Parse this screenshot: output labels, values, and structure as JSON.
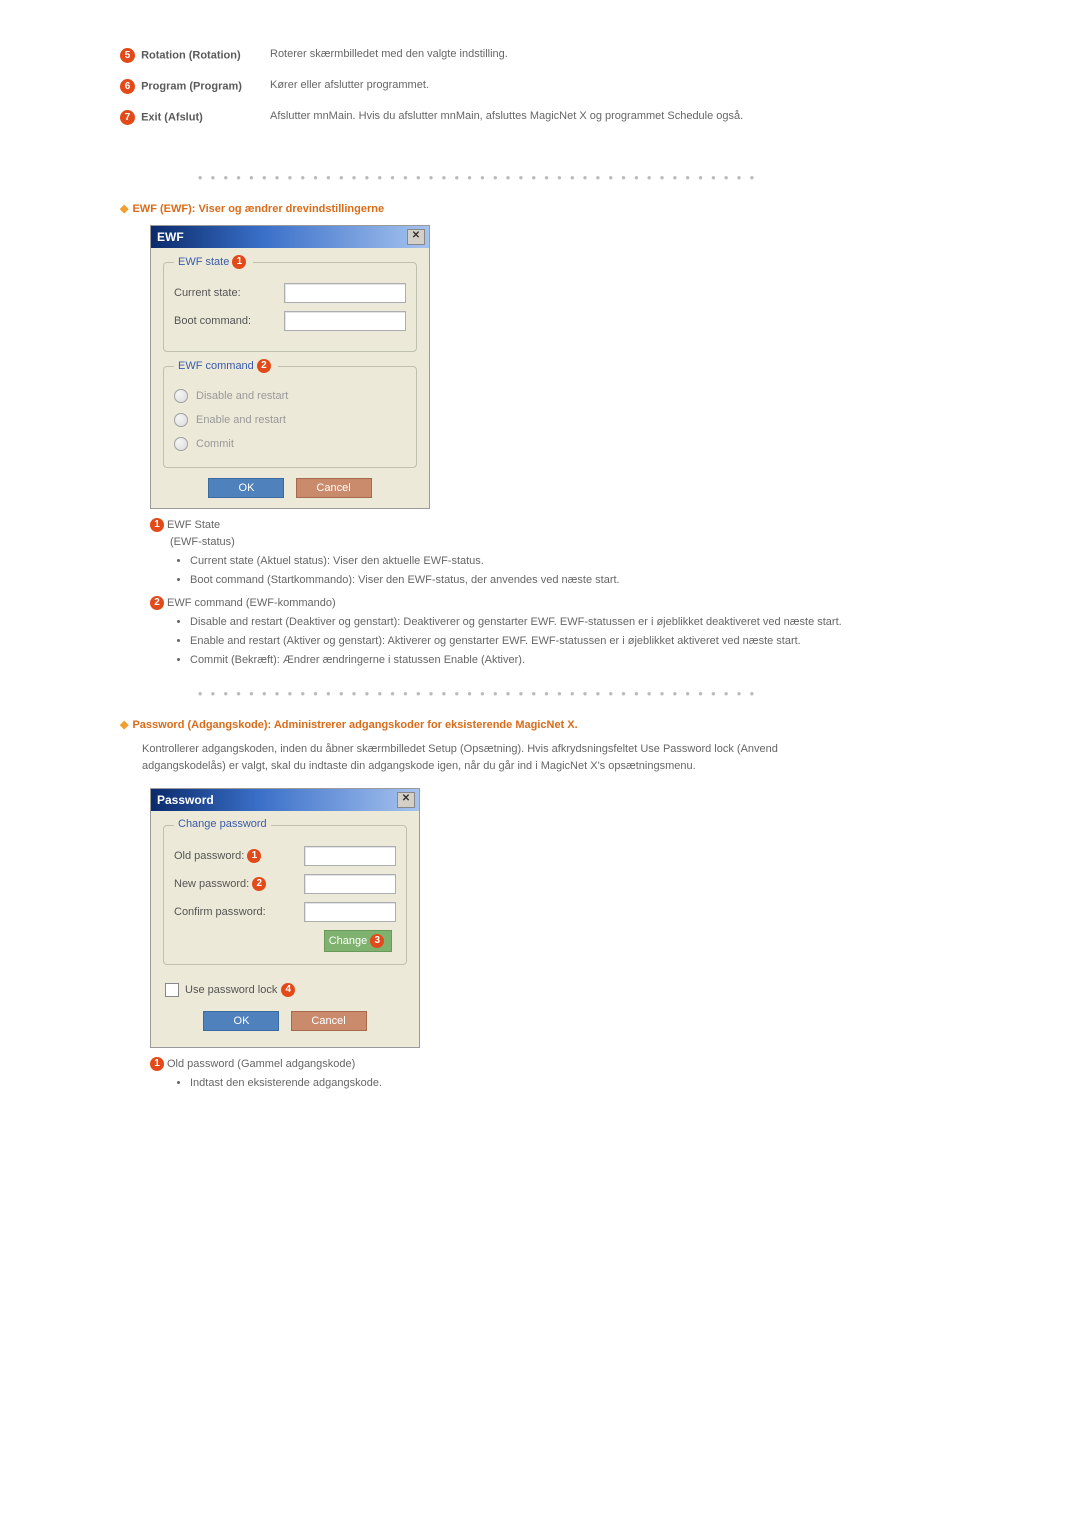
{
  "settings": {
    "rotation": {
      "num": "5",
      "label": "Rotation (Rotation)",
      "desc": "Roterer skærmbilledet med den valgte indstilling."
    },
    "program": {
      "num": "6",
      "label": "Program (Program)",
      "desc": "Kører eller afslutter programmet."
    },
    "exit": {
      "num": "7",
      "label": "Exit (Afslut)",
      "desc": "Afslutter mnMain. Hvis du afslutter mnMain, afsluttes MagicNet X og programmet Schedule også."
    }
  },
  "ewf": {
    "heading": "EWF (EWF): Viser og ændrer drevindstillingerne",
    "dialog_title": "EWF",
    "state_legend": "EWF state",
    "state_num": "1",
    "current_state_label": "Current state:",
    "boot_cmd_label": "Boot command:",
    "cmd_legend": "EWF command",
    "cmd_num": "2",
    "radio_disable": "Disable and restart",
    "radio_enable": "Enable and restart",
    "radio_commit": "Commit",
    "ok_label": "OK",
    "cancel_label": "Cancel",
    "list": {
      "state_title": "EWF State",
      "state_sub": "(EWF-status)",
      "state_items": [
        "Current state (Aktuel status): Viser den aktuelle EWF-status.",
        "Boot command (Startkommando): Viser den EWF-status, der anvendes ved næste start."
      ],
      "cmd_title": "EWF command (EWF-kommando)",
      "cmd_items": [
        "Disable and restart (Deaktiver og genstart): Deaktiverer og genstarter EWF. EWF-statussen er i øjeblikket deaktiveret ved næste start.",
        "Enable and restart (Aktiver og genstart): Aktiverer og genstarter EWF. EWF-statussen er i øjeblikket aktiveret ved næste start.",
        "Commit (Bekræft): Ændrer ændringerne i statussen Enable (Aktiver)."
      ]
    }
  },
  "pwd": {
    "heading": "Password (Adgangskode): Administrerer adgangskoder for eksisterende MagicNet X.",
    "intro": "Kontrollerer adgangskoden, inden du åbner skærmbilledet Setup (Opsætning). Hvis afkrydsningsfeltet Use Password lock (Anvend adgangskodelås) er valgt, skal du indtaste din adgangskode igen, når du går ind i MagicNet X's opsætningsmenu.",
    "dialog_title": "Password",
    "group_legend": "Change password",
    "old_label": "Old password:",
    "old_num": "1",
    "new_label": "New password:",
    "new_num": "2",
    "confirm_label": "Confirm password:",
    "change_btn": "Change",
    "change_num": "3",
    "use_lock_label": "Use password lock",
    "use_lock_num": "4",
    "ok_label": "OK",
    "cancel_label": "Cancel",
    "list": {
      "old_num": "1",
      "old_title": "Old password (Gammel adgangskode)",
      "old_items": [
        "Indtast den eksisterende adgangskode."
      ]
    }
  }
}
